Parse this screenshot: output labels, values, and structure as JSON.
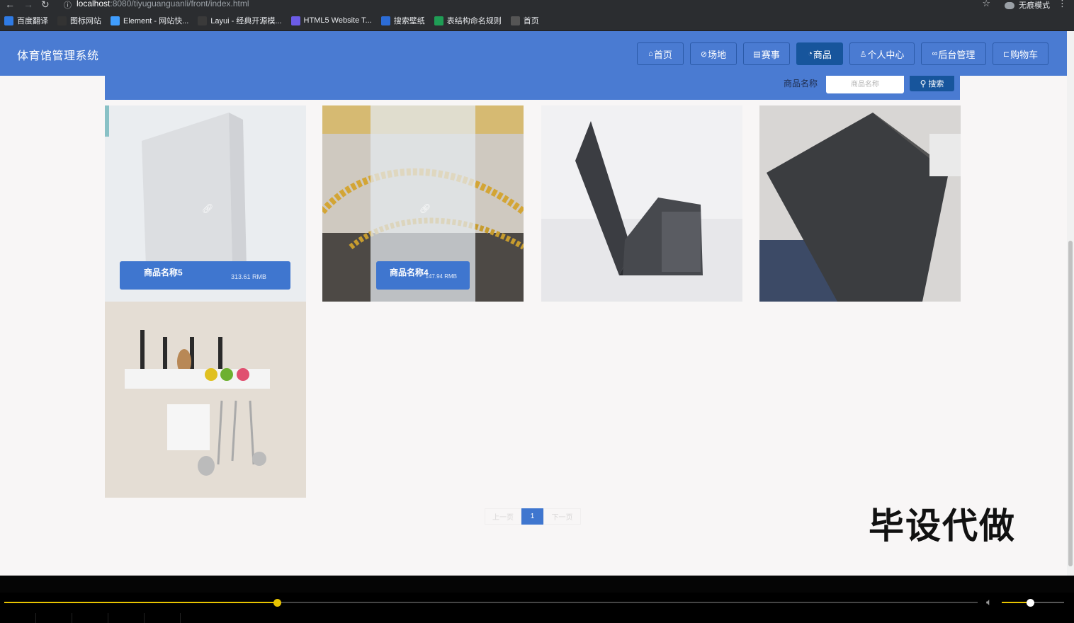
{
  "browser": {
    "url_host": "localhost",
    "url_path": ":8080/tiyuguanguanli/front/index.html",
    "incognito_label": "无痕模式",
    "bookmarks": [
      {
        "label": "百度翻译",
        "icon": "translate-icon",
        "color": "#2f7be5"
      },
      {
        "label": "图标网站",
        "icon": "flag-icon",
        "color": "#333333"
      },
      {
        "label": "Element - 网站快...",
        "icon": "element-icon",
        "color": "#409eff"
      },
      {
        "label": "Layui - 经典开源模...",
        "icon": "layui-icon",
        "color": "#3a3a3a"
      },
      {
        "label": "HTML5 Website T...",
        "icon": "html5-icon",
        "color": "#6c5ce7"
      },
      {
        "label": "搜索壁纸",
        "icon": "wallpaper-icon",
        "color": "#2c6cd6"
      },
      {
        "label": "表结构命名规则",
        "icon": "sheet-icon",
        "color": "#1f9d55"
      },
      {
        "label": "首页",
        "icon": "globe-icon",
        "color": "#555555"
      }
    ]
  },
  "header": {
    "title": "体育馆管理系统",
    "nav": [
      {
        "label": "首页",
        "icon": "home-icon",
        "glyph": "⌂",
        "active": false
      },
      {
        "label": "场地",
        "icon": "venue-icon",
        "glyph": "⊘",
        "active": false
      },
      {
        "label": "赛事",
        "icon": "event-icon",
        "glyph": "▤",
        "active": false
      },
      {
        "label": "商品",
        "icon": "goods-icon",
        "glyph": "◔",
        "active": true
      },
      {
        "label": "个人中心",
        "icon": "user-icon",
        "glyph": "♙",
        "active": false
      },
      {
        "label": "后台管理",
        "icon": "link-icon",
        "glyph": "∞",
        "active": false
      },
      {
        "label": "购物车",
        "icon": "cart-icon",
        "glyph": "⊏",
        "active": false
      }
    ]
  },
  "search": {
    "label": "商品名称",
    "placeholder": "商品名称",
    "button_label": "搜索"
  },
  "products": [
    {
      "name": "商品名称5",
      "price": "313.61 RMB",
      "hover": true
    },
    {
      "name": "商品名称4",
      "price": "147.94 RMB",
      "hover": true
    },
    {
      "name": "",
      "price": "",
      "hover": false
    },
    {
      "name": "",
      "price": "",
      "hover": false
    },
    {
      "name": "",
      "price": "",
      "hover": false
    }
  ],
  "pagination": {
    "prev": "上一页",
    "current": "1",
    "next": "下一页"
  },
  "watermark": "毕设代做",
  "player": {
    "progress": 0.28,
    "volume": 0.45
  }
}
